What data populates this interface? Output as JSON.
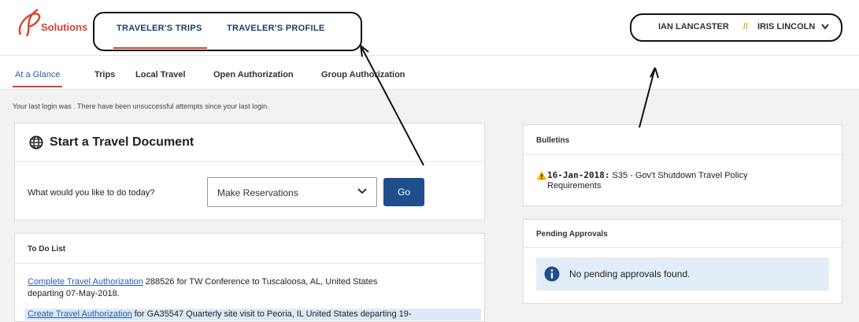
{
  "brand": {
    "logo_text": "Solutions",
    "accent": "#d9412a"
  },
  "top_nav": {
    "items": [
      {
        "label": "TRAVELER'S TRIPS",
        "active": true
      },
      {
        "label": "TRAVELER'S PROFILE",
        "active": false
      }
    ]
  },
  "user_menu": {
    "user": "IAN LANCASTER",
    "separator": "//",
    "delegate": "IRIS LINCOLN",
    "icon": "chevron-down-icon"
  },
  "sub_nav": {
    "items": [
      {
        "label": "At a Glance",
        "active": true
      },
      {
        "label": "Trips"
      },
      {
        "label": "Local Travel"
      },
      {
        "label": "Open Authorization"
      },
      {
        "label": "Group Authorization"
      }
    ]
  },
  "login_note": "Your last login was . There have been unsuccessful attempts since your last login.",
  "start_doc": {
    "title": "Start a Travel Document",
    "icon": "globe-icon",
    "question": "What would you like to do today?",
    "select_value": "Make Reservations",
    "go_label": "Go"
  },
  "todo": {
    "title": "To Do List",
    "items": [
      {
        "link": "Complete Travel Authorization",
        "text": " 288526 for TW Conference to Tuscaloosa, AL, United States",
        "line2": "departing 07-May-2018."
      },
      {
        "link": "Create Travel Authorization",
        "text": " for GA35547 Quarterly site visit to Peoria, IL United States departing 19-"
      }
    ]
  },
  "bulletins": {
    "title": "Bulletins",
    "date": "16-Jan-2018:",
    "text": " S35 - Gov't Shutdown Travel Policy",
    "text2": "Requirements",
    "icon": "warning-icon"
  },
  "pending": {
    "title": "Pending Approvals",
    "message": "No pending approvals found.",
    "icon": "info-icon"
  }
}
